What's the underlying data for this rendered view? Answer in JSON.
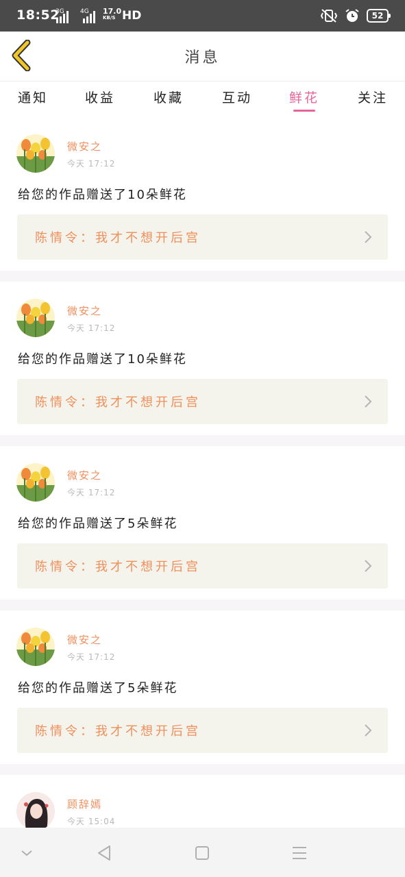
{
  "status_bar": {
    "time": "18:52",
    "net1": "3G",
    "net2": "4G",
    "speed_value": "17.0",
    "speed_unit": "KB/S",
    "hd": "HD",
    "battery": "52"
  },
  "header": {
    "title": "消息"
  },
  "tabs": [
    {
      "label": "通知"
    },
    {
      "label": "收益"
    },
    {
      "label": "收藏"
    },
    {
      "label": "互动"
    },
    {
      "label": "鲜花",
      "active": true
    },
    {
      "label": "关注"
    }
  ],
  "messages": [
    {
      "username": "微安之",
      "time": "今天 17:12",
      "text": "给您的作品赠送了10朵鲜花",
      "work": "陈情令：我才不想开后宫"
    },
    {
      "username": "微安之",
      "time": "今天 17:12",
      "text": "给您的作品赠送了10朵鲜花",
      "work": "陈情令：我才不想开后宫"
    },
    {
      "username": "微安之",
      "time": "今天 17:12",
      "text": "给您的作品赠送了5朵鲜花",
      "work": "陈情令：我才不想开后宫"
    },
    {
      "username": "微安之",
      "time": "今天 17:12",
      "text": "给您的作品赠送了5朵鲜花",
      "work": "陈情令：我才不想开后宫"
    },
    {
      "username": "顾辞嫣",
      "time": "今天 15:04"
    }
  ],
  "colors": {
    "accent": "#e7649a",
    "name": "#ef8f5c",
    "work_bg": "#f4f4ec",
    "back_arrow": "#f0c52a"
  },
  "icons": {
    "back": "chevron-left-icon",
    "work_arrow": "chevron-right-icon",
    "nav": [
      "chevron-down-icon",
      "back-triangle-icon",
      "home-square-icon",
      "menu-icon"
    ]
  }
}
